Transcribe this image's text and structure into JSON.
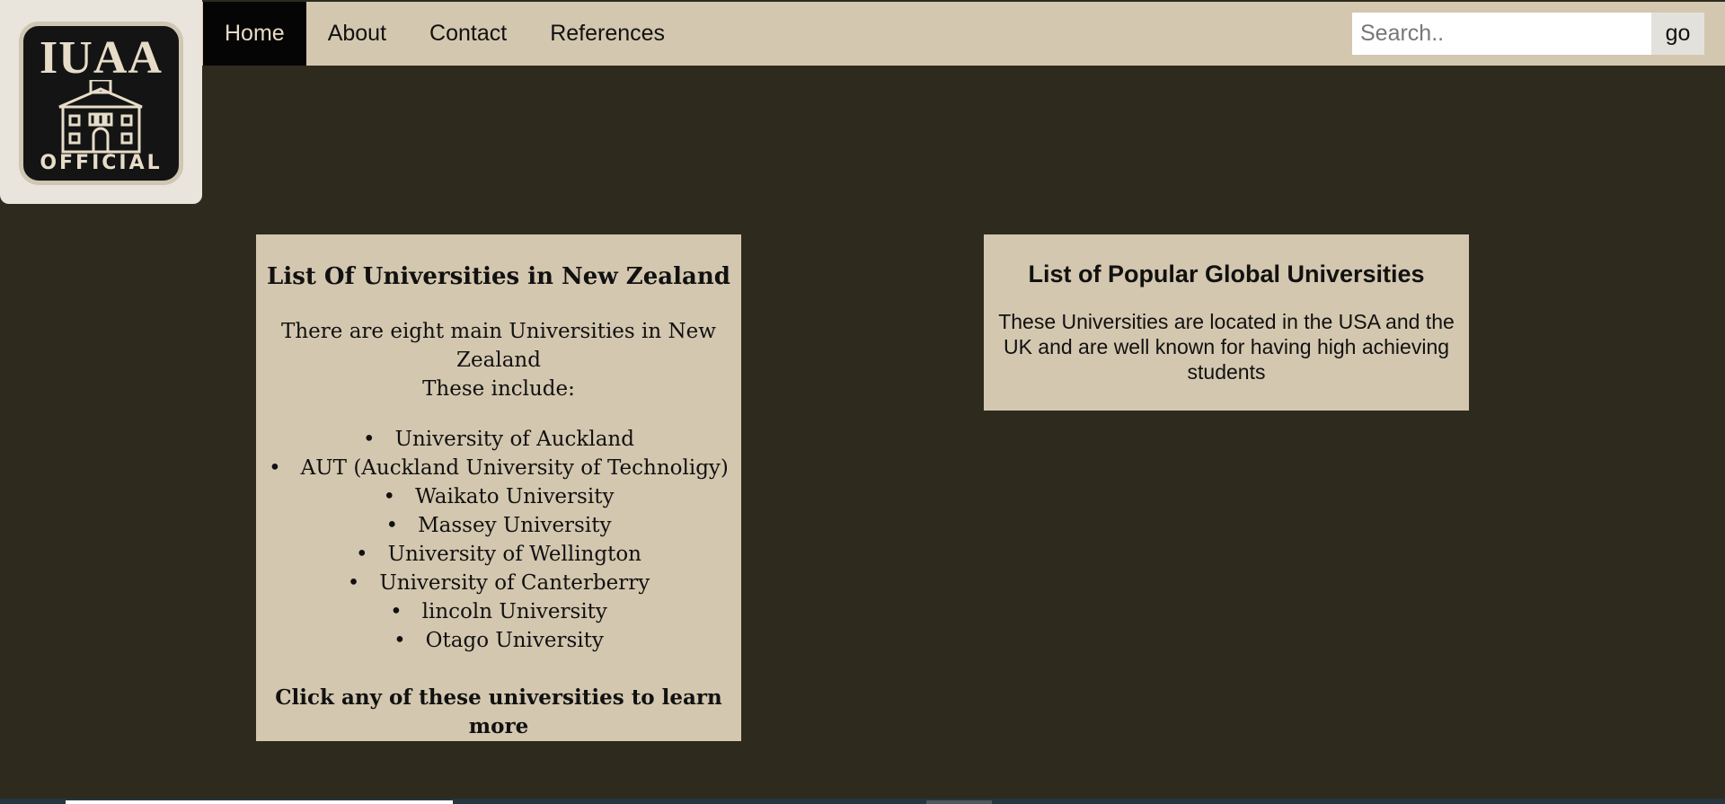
{
  "logo": {
    "title": "IUAA",
    "subtitle": "OFFICIAL",
    "icon": "school-building-icon"
  },
  "nav": {
    "items": [
      {
        "label": "Home",
        "active": true
      },
      {
        "label": "About",
        "active": false
      },
      {
        "label": "Contact",
        "active": false
      },
      {
        "label": "References",
        "active": false
      }
    ]
  },
  "search": {
    "placeholder": "Search..",
    "value": "",
    "button_label": "go"
  },
  "nz_card": {
    "title": "List Of Universities in New Zealand",
    "intro_line1": "There are eight main Universities in New Zealand",
    "intro_line2": "These include:",
    "universities": [
      "University of Auckland",
      "AUT (Auckland University of Technoligy)",
      "Waikato University",
      "Massey University",
      "University of Wellington",
      "University of Canterberry",
      "lincoln University",
      "Otago University"
    ],
    "cta": "Click any of these universities to learn more"
  },
  "global_card": {
    "title": "List of Popular Global Universities",
    "description": "These Universities are located in the USA and the UK and are well known for having high achieving students"
  },
  "colors": {
    "background": "#2e2b1e",
    "navbar": "#d4c7af",
    "nav_active": "#050505",
    "card": "#d4c7af",
    "logo_box": "#e9e4dc"
  }
}
